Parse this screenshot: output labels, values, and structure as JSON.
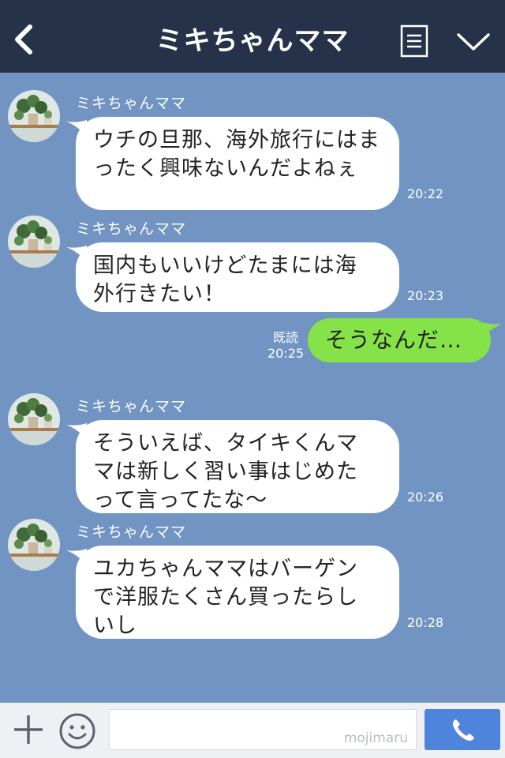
{
  "header": {
    "title": "ミキちゃんママ",
    "back_icon": "chevron-left-icon",
    "menu_icon": "list-icon",
    "collapse_icon": "chevron-down-icon"
  },
  "messages": [
    {
      "sender": "ミキちゃんママ",
      "line1": "ウチの旦那、海外旅行にはま",
      "line2": "ったく興味ないんだよねぇ",
      "time": "20:22"
    },
    {
      "sender": "ミキちゃんママ",
      "line1": "国内もいいけどたまには海",
      "line2": "外行きたい！",
      "time": "20:23"
    },
    {
      "outgoing": true,
      "text": "そうなんだ…",
      "read_label": "既読",
      "time": "20:25"
    },
    {
      "sender": "ミキちゃんママ",
      "line1": "そういえば、タイキくんマ",
      "line2": "マは新しく習い事はじめた",
      "line3": "って言ってたな〜",
      "time": "20:26"
    },
    {
      "sender": "ミキちゃんママ",
      "line1": "ユカちゃんママはバーゲン",
      "line2": "で洋服たくさん買ったらし",
      "line3": "いし",
      "time": "20:28"
    }
  ],
  "input": {
    "placeholder": "",
    "watermark": "mojimaru"
  },
  "icons": {
    "add": "plus-icon",
    "emoji": "smiley-icon",
    "call": "phone-icon"
  },
  "colors": {
    "header_bg": "#253249",
    "chat_bg": "#7294c3",
    "incoming_bubble": "#ffffff",
    "outgoing_bubble": "#85e249",
    "call_button": "#4e84dc"
  }
}
